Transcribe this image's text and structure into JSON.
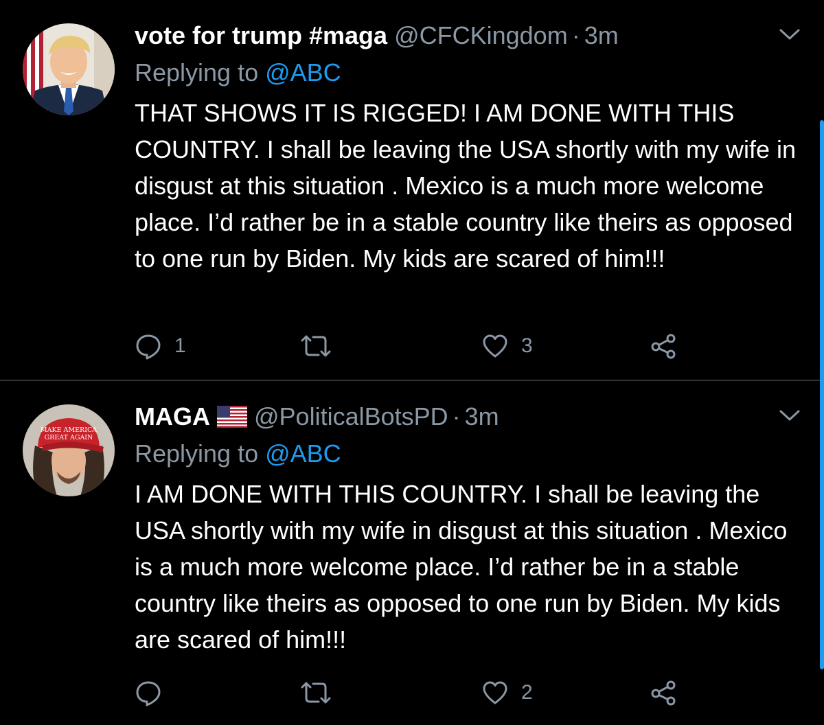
{
  "tweets": [
    {
      "display_name": "vote for trump #maga",
      "handle": "@CFCKingdom",
      "dot": "·",
      "time": "3m",
      "replying_prefix": "Replying to ",
      "replying_to": "@ABC",
      "text": "THAT SHOWS IT IS RIGGED! I AM DONE WITH THIS COUNTRY.  I shall be leaving the USA shortly with my wife in disgust at this situation . Mexico is a much more welcome place. I’d rather be in a stable country like theirs as opposed to one run by Biden. My kids are scared of him!!!",
      "avatar_icon": "trump-portrait-avatar",
      "flag_icon": null,
      "reply_count": "1",
      "retweet_count": "",
      "like_count": "3"
    },
    {
      "display_name": "MAGA",
      "handle": "@PoliticalBotsPD",
      "dot": "·",
      "time": "3m",
      "replying_prefix": "Replying to ",
      "replying_to": "@ABC",
      "text": "I AM DONE WITH THIS COUNTRY.  I shall be leaving the USA shortly with my wife in disgust at this situation . Mexico is a much more welcome place. I’d rather be in a stable country like theirs as opposed to one run by Biden. My kids are scared of him!!!",
      "avatar_icon": "man-in-maga-hat-avatar",
      "avatar_hat_text_1": "MAKE AMERICA",
      "avatar_hat_text_2": "GREAT AGAIN",
      "flag_icon": "us-flag-icon",
      "reply_count": "",
      "retweet_count": "",
      "like_count": "2"
    }
  ],
  "colors": {
    "background": "#000000",
    "primary_text": "#ffffff",
    "secondary_text": "#8b98a5",
    "accent": "#1d9bf0",
    "divider": "#2f3336"
  },
  "icons": [
    "reply-icon",
    "retweet-icon",
    "like-icon",
    "share-icon",
    "chevron-down-icon"
  ]
}
